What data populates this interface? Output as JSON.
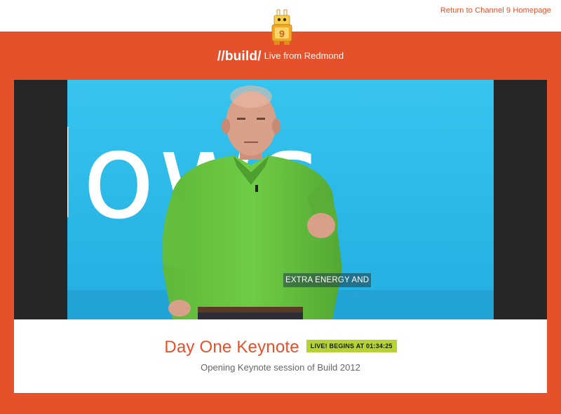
{
  "header": {
    "return_link": "Return to Channel 9 Homepage"
  },
  "brand": {
    "logo_text": "//build/",
    "tagline": "Live from Redmond"
  },
  "video": {
    "caption": "EXTRA ENERGY AND",
    "screen_text": "lows"
  },
  "event": {
    "title": "Day One Keynote",
    "badge": "LIVE! BEGINS AT 01:34:25",
    "description": "Opening Keynote session of Build 2012"
  },
  "colors": {
    "accent": "#e4512b",
    "badge": "#b6d334",
    "video_background": "#2fbde9",
    "letterbox": "#262626"
  },
  "icons": {
    "mascot": "channel9-mascot-icon"
  }
}
